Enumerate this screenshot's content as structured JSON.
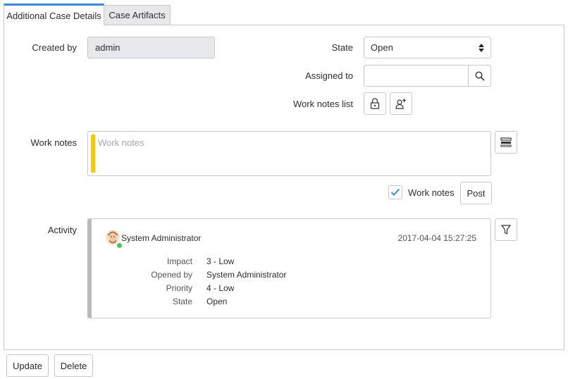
{
  "tabs": [
    {
      "label": "Additional Case Details",
      "active": true
    },
    {
      "label": "Case Artifacts",
      "active": false
    }
  ],
  "form": {
    "created_by": {
      "label": "Created by",
      "value": "admin"
    },
    "state": {
      "label": "State",
      "value": "Open"
    },
    "assigned_to": {
      "label": "Assigned to",
      "value": ""
    },
    "work_notes_list": {
      "label": "Work notes list"
    },
    "work_notes": {
      "label": "Work notes",
      "placeholder": "Work notes"
    },
    "work_notes_checkbox": {
      "label": "Work notes",
      "checked": true
    },
    "post_button": "Post",
    "activity": {
      "label": "Activity"
    }
  },
  "activity_entry": {
    "author": "System Administrator",
    "timestamp": "2017-04-04 15:27:25",
    "fields": [
      {
        "name": "Impact",
        "value": "3 - Low"
      },
      {
        "name": "Opened by",
        "value": "System Administrator"
      },
      {
        "name": "Priority",
        "value": "4 - Low"
      },
      {
        "name": "State",
        "value": "Open"
      }
    ]
  },
  "footer": {
    "update_button": "Update",
    "delete_button": "Delete"
  },
  "colors": {
    "accent": "#3b8ad8",
    "mandatory_bar": "#fcc800",
    "online": "#4ec35d",
    "checkbox_check": "#3b8ad8"
  },
  "icons": {
    "search": "search-icon",
    "lock": "lock-icon",
    "add_user": "add-user-icon",
    "toggle_fields": "list-toggle-icon",
    "filter": "filter-icon",
    "check": "check-icon",
    "select_arrows": "select-arrows-icon"
  }
}
